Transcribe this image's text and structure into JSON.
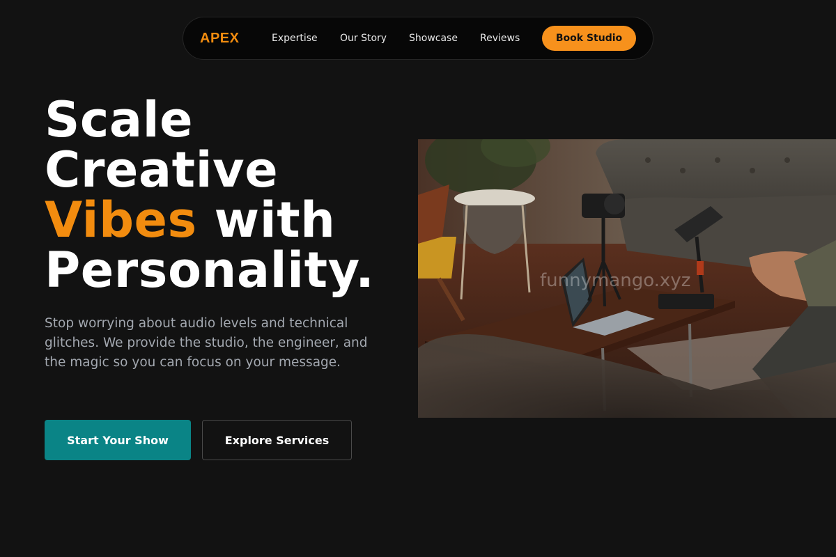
{
  "nav": {
    "logo": "APEX",
    "links": [
      "Expertise",
      "Our Story",
      "Showcase",
      "Reviews"
    ],
    "cta": "Book Studio"
  },
  "hero": {
    "headline_line1": "Scale",
    "headline_line2": "Creative",
    "headline_accent": "Vibes",
    "headline_line3_rest": " with",
    "headline_line4": "Personality.",
    "subtitle": "Stop worrying about audio levels and technical glitches. We provide the studio, the engineer, and the magic so you can focus on your message.",
    "primary_button": "Start Your Show",
    "secondary_button": "Explore Services"
  },
  "image": {
    "watermark": "funnymango.xyz"
  },
  "colors": {
    "background": "#121212",
    "accent_orange": "#f28c0f",
    "teal": "#0a8486"
  }
}
